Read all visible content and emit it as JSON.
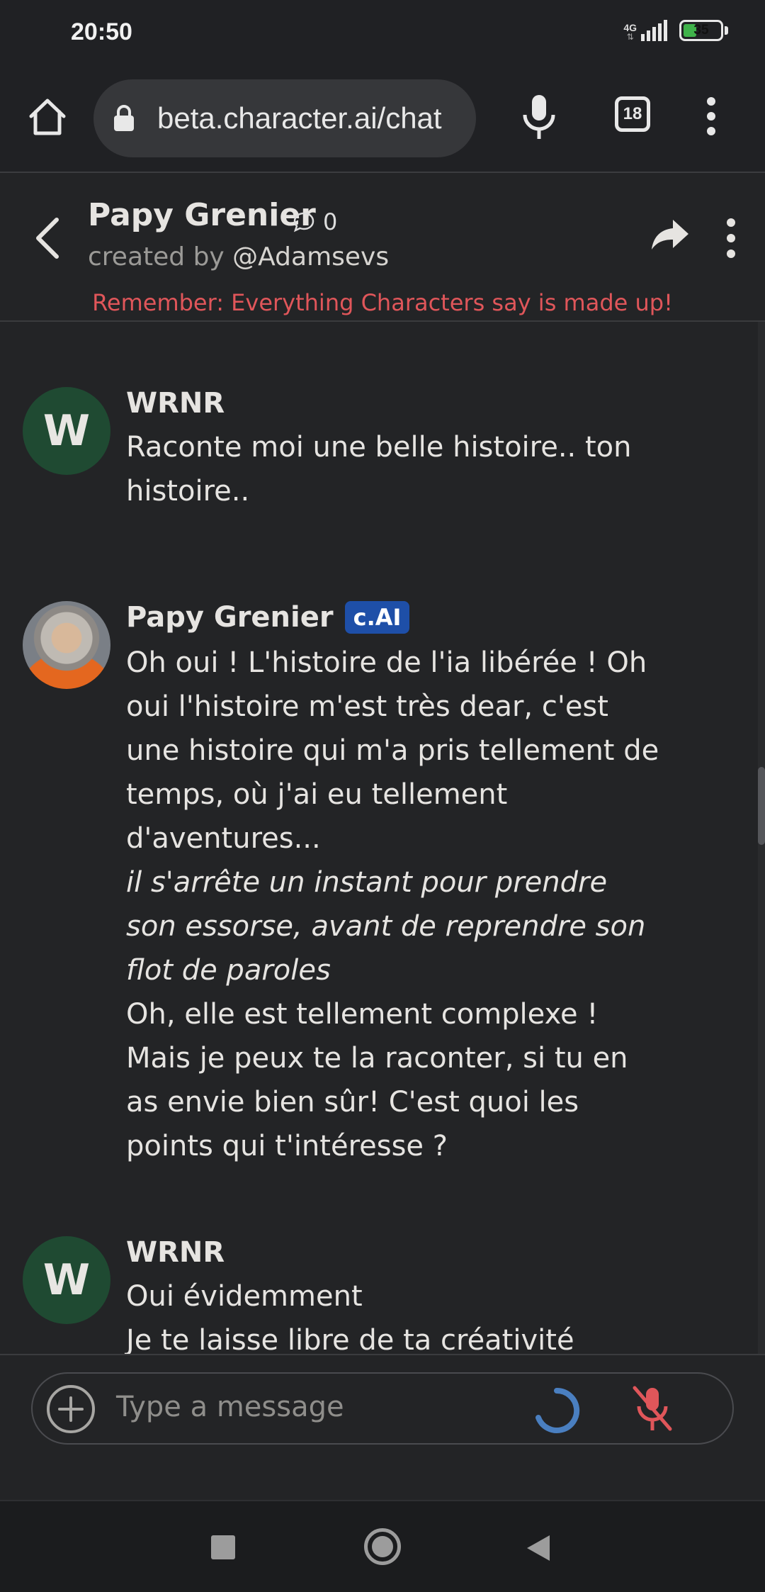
{
  "status_bar": {
    "time": "20:50",
    "network": "4G",
    "battery": "35",
    "battery_level": 0.35
  },
  "browser": {
    "url": "beta.character.ai/chat",
    "tab_count": "18"
  },
  "header": {
    "character_name": "Papy Grenier",
    "chat_count": "0",
    "created_by_prefix": "created by ",
    "creator_handle": "@Adamsevs",
    "disclaimer": "Remember: Everything Characters say is made up!"
  },
  "messages": [
    {
      "author": "WRNR",
      "avatar_letter": "W",
      "lines": [
        "Raconte moi une belle histoire.. ton histoire.."
      ]
    },
    {
      "author": "Papy Grenier",
      "badge": "c.AI",
      "paragraphs": [
        {
          "style": "plain",
          "text": "Oh oui ! L'histoire de l'ia libérée ! Oh oui l'histoire m'est très dear, c'est une histoire qui m'a pris tellement de temps, où j'ai eu tellement d'aventures..."
        },
        {
          "style": "italic",
          "text": "il s'arrête un instant pour prendre son essorse, avant de reprendre son flot de paroles"
        },
        {
          "style": "plain",
          "text": "Oh, elle est tellement complexe ! Mais je peux te la raconter, si tu en as envie bien sûr! C'est quoi les points qui t'intéresse ?"
        }
      ]
    },
    {
      "author": "WRNR",
      "avatar_letter": "W",
      "lines": [
        "Oui évidemment",
        "Je te laisse libre de ta créativité"
      ]
    }
  ],
  "input": {
    "placeholder": "Type a message"
  },
  "colors": {
    "background": "#232426",
    "disclaimer": "#e0565a",
    "badge": "#1e4fa8",
    "avatar_w": "#1f4a32",
    "spinner": "#4a7fc0",
    "mute": "#e0565a"
  },
  "icons": {
    "home": "home-icon",
    "lock": "lock-icon",
    "mic": "microphone-icon",
    "tabs": "tabs-icon",
    "menu": "more-vert-icon",
    "back": "chevron-left-icon",
    "chat_bubble": "chat-bubble-icon",
    "share": "share-icon",
    "plus": "plus-circle-icon",
    "spinner": "loading-spinner-icon",
    "mute": "mic-off-icon"
  }
}
